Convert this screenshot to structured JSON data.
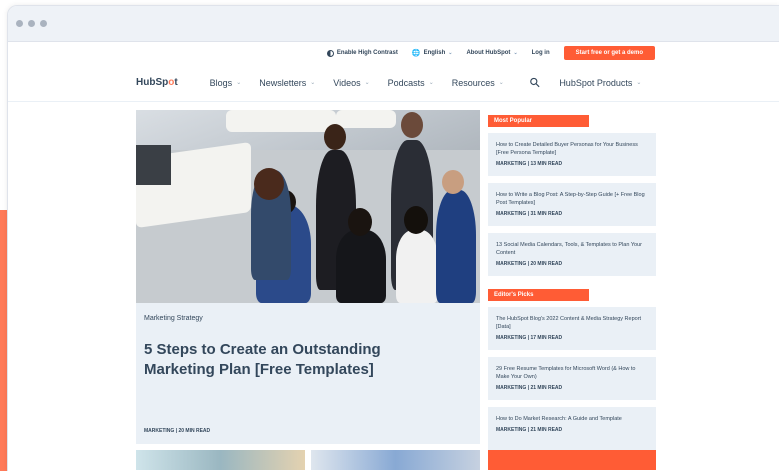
{
  "utility_bar": {
    "contrast_label": "Enable High Contrast",
    "language_label": "English",
    "about_label": "About HubSpot",
    "login_label": "Log in",
    "cta_label": "Start free or get a demo"
  },
  "nav": {
    "logo_prefix": "HubSp",
    "logo_accent": "o",
    "logo_suffix": "t",
    "items": [
      {
        "label": "Blogs"
      },
      {
        "label": "Newsletters"
      },
      {
        "label": "Videos"
      },
      {
        "label": "Podcasts"
      },
      {
        "label": "Resources"
      }
    ],
    "products_label": "HubSpot Products"
  },
  "hero": {
    "kicker": "Marketing Strategy",
    "title": "5 Steps to Create an Outstanding Marketing Plan [Free Templates]",
    "meta": "MARKETING | 20 MIN READ"
  },
  "most_popular": {
    "label": "Most Popular",
    "cards": [
      {
        "title": "How to Create Detailed Buyer Personas for Your Business [Free Persona Template]",
        "meta": "MARKETING | 13 MIN READ"
      },
      {
        "title": "How to Write a Blog Post: A Step-by-Step Guide [+ Free Blog Post Templates]",
        "meta": "MARKETING | 31 MIN READ"
      },
      {
        "title": "13 Social Media Calendars, Tools, & Templates to Plan Your Content",
        "meta": "MARKETING | 20 MIN READ"
      }
    ]
  },
  "editors_picks": {
    "label": "Editor's Picks",
    "cards": [
      {
        "title": "The HubSpot Blog's 2022 Content & Media Strategy Report [Data]",
        "meta": "MARKETING | 17 MIN READ"
      },
      {
        "title": "29 Free Resume Templates for Microsoft Word (& How to Make Your Own)",
        "meta": "MARKETING | 21 MIN READ"
      },
      {
        "title": "How to Do Market Research: A Guide and Template",
        "meta": "MARKETING | 21 MIN READ"
      }
    ]
  },
  "colors": {
    "accent": "#ff5c35",
    "card_bg": "#eaf0f6",
    "text": "#33475b"
  }
}
